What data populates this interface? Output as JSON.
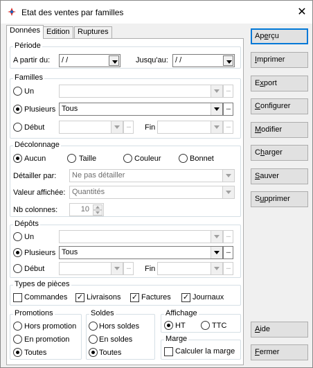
{
  "window": {
    "title": "Etat des ventes par familles",
    "close_glyph": "✕"
  },
  "tabs": [
    "Données",
    "Edition",
    "Ruptures"
  ],
  "periode": {
    "legend": "Période",
    "from_label": "A partir du:",
    "from_value": " / /",
    "to_label": "Jusqu'au:",
    "to_value": " / /"
  },
  "familles": {
    "legend": "Familles",
    "un_label": "Un",
    "plusieurs_label": "Plusieurs",
    "plusieurs_value": "Tous",
    "debut_label": "Début",
    "fin_label": "Fin",
    "selected": "Plusieurs"
  },
  "decolonnage": {
    "legend": "Décolonnage",
    "options": [
      "Aucun",
      "Taille",
      "Couleur",
      "Bonnet"
    ],
    "selected": "Aucun",
    "detailler_label": "Détailler par:",
    "detailler_value": "Ne pas détailler",
    "valeur_label": "Valeur affichée:",
    "valeur_value": "Quantités",
    "nbcol_label": "Nb colonnes:",
    "nbcol_value": "10"
  },
  "depots": {
    "legend": "Dépôts",
    "un_label": "Un",
    "plusieurs_label": "Plusieurs",
    "plusieurs_value": "Tous",
    "debut_label": "Début",
    "fin_label": "Fin",
    "selected": "Plusieurs"
  },
  "types": {
    "legend": "Types de pièces",
    "items": [
      {
        "label": "Commandes",
        "checked": false
      },
      {
        "label": "Livraisons",
        "checked": true
      },
      {
        "label": "Factures",
        "checked": true
      },
      {
        "label": "Journaux",
        "checked": true
      }
    ]
  },
  "promotions": {
    "legend": "Promotions",
    "options": [
      "Hors promotion",
      "En promotion",
      "Toutes"
    ],
    "selected": "Toutes"
  },
  "soldes": {
    "legend": "Soldes",
    "options": [
      "Hors soldes",
      "En soldes",
      "Toutes"
    ],
    "selected": "Toutes"
  },
  "affichage": {
    "legend": "Affichage",
    "options": [
      "HT",
      "TTC"
    ],
    "selected": "HT"
  },
  "marge": {
    "legend": "Marge",
    "label": "Calculer la marge",
    "checked": false
  },
  "buttons": {
    "apercu": {
      "pre": "Ap",
      "u": "e",
      "post": "rçu"
    },
    "imprimer": {
      "pre": "",
      "u": "I",
      "post": "mprimer"
    },
    "export": {
      "pre": "E",
      "u": "x",
      "post": "port"
    },
    "configurer": {
      "pre": "",
      "u": "C",
      "post": "onfigurer"
    },
    "modifier": {
      "pre": "",
      "u": "M",
      "post": "odifier"
    },
    "charger": {
      "pre": "C",
      "u": "h",
      "post": "arger"
    },
    "sauver": {
      "pre": "",
      "u": "S",
      "post": "auver"
    },
    "supprimer": {
      "pre": "S",
      "u": "u",
      "post": "pprimer"
    },
    "aide": {
      "pre": "",
      "u": "A",
      "post": "ide"
    },
    "fermer": {
      "pre": "",
      "u": "F",
      "post": "ermer"
    }
  },
  "colors": {
    "accent": "#0078d7",
    "app_icon": "#d32f2f"
  },
  "icons": {
    "app": "app-icon",
    "close": "close-icon",
    "dropdown": "chevron-down-icon",
    "browse": "ellipsis-icon"
  },
  "glyphs": {
    "check": "✓",
    "dots": "..."
  }
}
